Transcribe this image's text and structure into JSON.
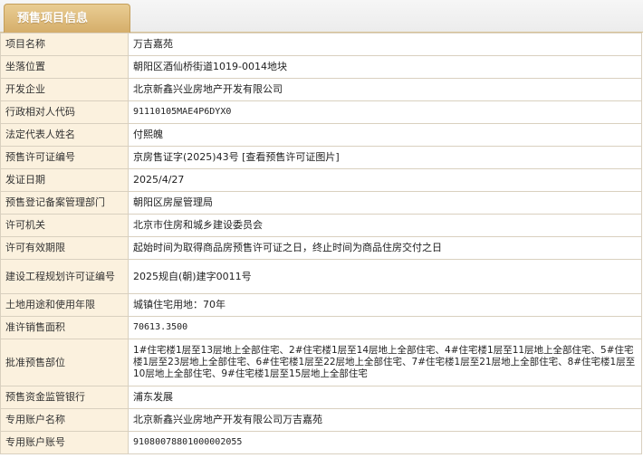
{
  "tab": {
    "title": "预售项目信息"
  },
  "rows": [
    {
      "label": "项目名称",
      "value": "万吉嘉苑"
    },
    {
      "label": "坐落位置",
      "value": "朝阳区酒仙桥街道1019-0014地块"
    },
    {
      "label": "开发企业",
      "value": "北京新鑫兴业房地产开发有限公司"
    },
    {
      "label": "行政相对人代码",
      "value": "91110105MAE4P6DYX0"
    },
    {
      "label": "法定代表人姓名",
      "value": "付熙魄"
    },
    {
      "label": "预售许可证编号",
      "value": "京房售证字(2025)43号",
      "link": "[查看预售许可证图片]"
    },
    {
      "label": "发证日期",
      "value": "2025/4/27"
    },
    {
      "label": "预售登记备案管理部门",
      "value": "朝阳区房屋管理局"
    },
    {
      "label": "许可机关",
      "value": "北京市住房和城乡建设委员会"
    },
    {
      "label": "许可有效期限",
      "value": "起始时间为取得商品房预售许可证之日，终止时间为商品住房交付之日"
    },
    {
      "label": "建设工程规划许可证编号",
      "value": "2025规自(朝)建字0011号"
    },
    {
      "label": "土地用途和使用年限",
      "value": "城镇住宅用地：70年"
    },
    {
      "label": "准许销售面积",
      "value": "70613.3500"
    },
    {
      "label": "批准预售部位",
      "value": "1#住宅楼1层至13层地上全部住宅、2#住宅楼1层至14层地上全部住宅、4#住宅楼1层至11层地上全部住宅、5#住宅楼1层至23层地上全部住宅、6#住宅楼1层至22层地上全部住宅、7#住宅楼1层至21层地上全部住宅、8#住宅楼1层至10层地上全部住宅、9#住宅楼1层至15层地上全部住宅"
    },
    {
      "label": "预售资金监管银行",
      "value": "浦东发展"
    },
    {
      "label": "专用账户名称",
      "value": "北京新鑫兴业房地产开发有限公司万吉嘉苑"
    },
    {
      "label": "专用账户账号",
      "value": "91080078801000002055"
    }
  ]
}
